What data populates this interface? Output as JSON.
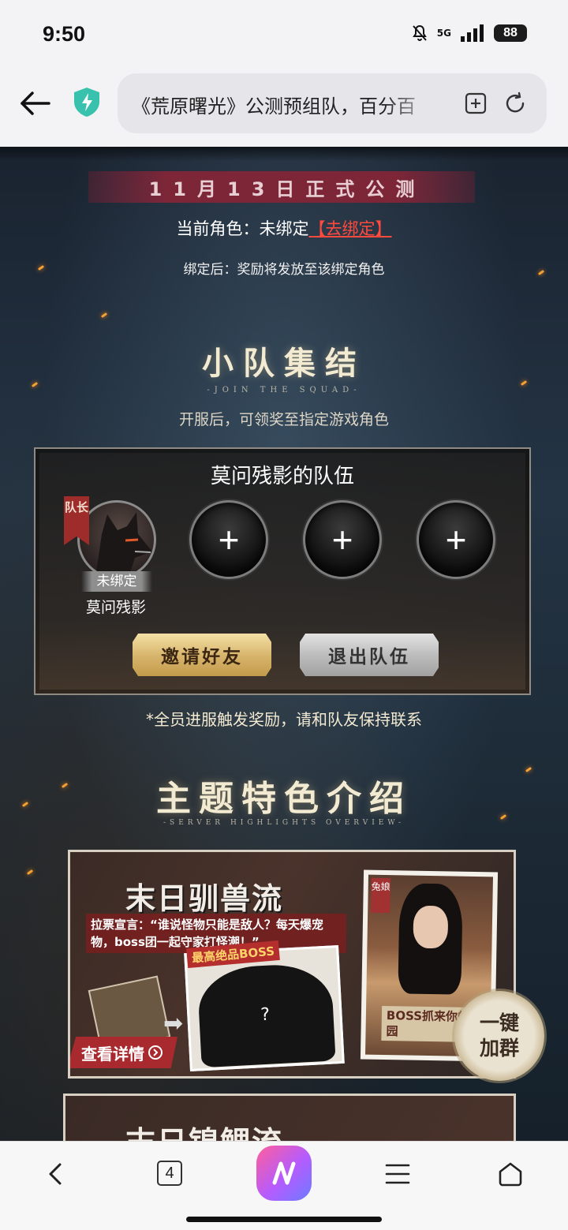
{
  "status_bar": {
    "time": "9:50",
    "network": "5G",
    "battery": "88"
  },
  "browser": {
    "url_title": "《荒原曙光》公测预组队，百分百",
    "tab_count": "4",
    "ai_glyph": "N"
  },
  "page": {
    "launch_date": "11月13日正式公测",
    "role_prefix": "当前角色：未绑定",
    "bind_link": "【去绑定】",
    "bind_note": "绑定后：奖励将发放至该绑定角色",
    "squad_section": {
      "title": "小队集结",
      "subtitle": "-JOIN THE SQUAD-",
      "desc": "开服后，可领奖至指定游戏角色"
    },
    "squad": {
      "name": "莫问残影的队伍",
      "leader_badge": "队长",
      "leader_status": "未绑定",
      "leader_name": "莫问残影",
      "empty_slot": "+",
      "invite_label": "邀请好友",
      "leave_label": "退出队伍",
      "note": "*全员进服触发奖励，请和队友保持联系"
    },
    "highlights_section": {
      "title": "主题特色介绍",
      "subtitle": "-SERVER HIGHLIGHTS OVERVIEW-"
    },
    "feature_card": {
      "title": "末日驯兽流",
      "quote": "拉票宣言：“谁说怪物只能是敌人？每天爆宠物，boss团一起守家打怪潮！”",
      "boss_label": "最高绝品BOSS",
      "boss_mystery": "?",
      "detail_label": "查看详情",
      "photo_tag": "兔娘",
      "photo_caption": "BOSS抓来你的家园",
      "join_line1": "一键",
      "join_line2": "加群"
    },
    "feature_card_2": {
      "title": "末日锦鲤流"
    }
  },
  "colors": {
    "accent_red": "#ff4a3d",
    "banner": "#7c2638",
    "invite_gold": "#d8b66e",
    "ai_gradient": "#b45cff"
  }
}
